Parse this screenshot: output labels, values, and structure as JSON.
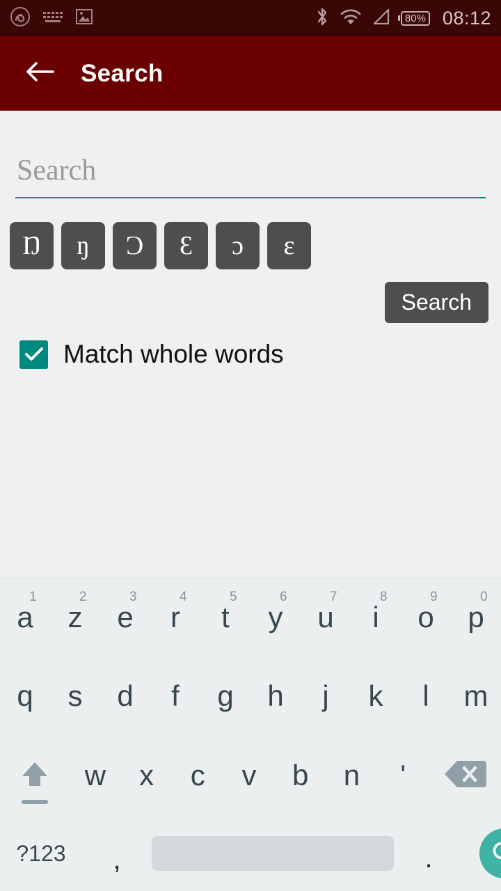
{
  "status_bar": {
    "icons_left": [
      "app-logo-icon",
      "keyboard-icon",
      "image-icon"
    ],
    "icons_right": [
      "bluetooth-icon",
      "wifi-icon",
      "signal-icon"
    ],
    "battery_level": "80%",
    "time": "08:12"
  },
  "app_bar": {
    "back_icon": "back-arrow-icon",
    "title": "Search"
  },
  "search_form": {
    "input_value": "",
    "input_placeholder": "Search",
    "special_chars": [
      "Ŋ",
      "ŋ",
      "Ɔ",
      "Ɛ",
      "ɔ",
      "ɛ"
    ],
    "search_button_label": "Search",
    "match_whole_words_label": "Match whole words",
    "match_whole_words_checked": true
  },
  "keyboard": {
    "row1": [
      {
        "letter": "a",
        "num": "1"
      },
      {
        "letter": "z",
        "num": "2"
      },
      {
        "letter": "e",
        "num": "3"
      },
      {
        "letter": "r",
        "num": "4"
      },
      {
        "letter": "t",
        "num": "5"
      },
      {
        "letter": "y",
        "num": "6"
      },
      {
        "letter": "u",
        "num": "7"
      },
      {
        "letter": "i",
        "num": "8"
      },
      {
        "letter": "o",
        "num": "9"
      },
      {
        "letter": "p",
        "num": "0"
      }
    ],
    "row2": [
      "q",
      "s",
      "d",
      "f",
      "g",
      "h",
      "j",
      "k",
      "l",
      "m"
    ],
    "row3": [
      "w",
      "x",
      "c",
      "v",
      "b",
      "n",
      "'"
    ],
    "shift_icon": "shift-up-arrow-icon",
    "delete_icon": "backspace-delete-icon",
    "symbols_label": "?123",
    "comma_label": ",",
    "period_label": ".",
    "space_label": "",
    "enter_icon": "search-magnifier-icon"
  },
  "colors": {
    "status_bar_bg": "#3a0606",
    "app_bar_bg": "#6b0000",
    "content_bg": "#eff0f1",
    "accent_teal": "#00897f",
    "enter_key_teal": "#3fb3a4",
    "char_key_bg": "#4e4e4e",
    "keyboard_bg": "#eceff0"
  }
}
